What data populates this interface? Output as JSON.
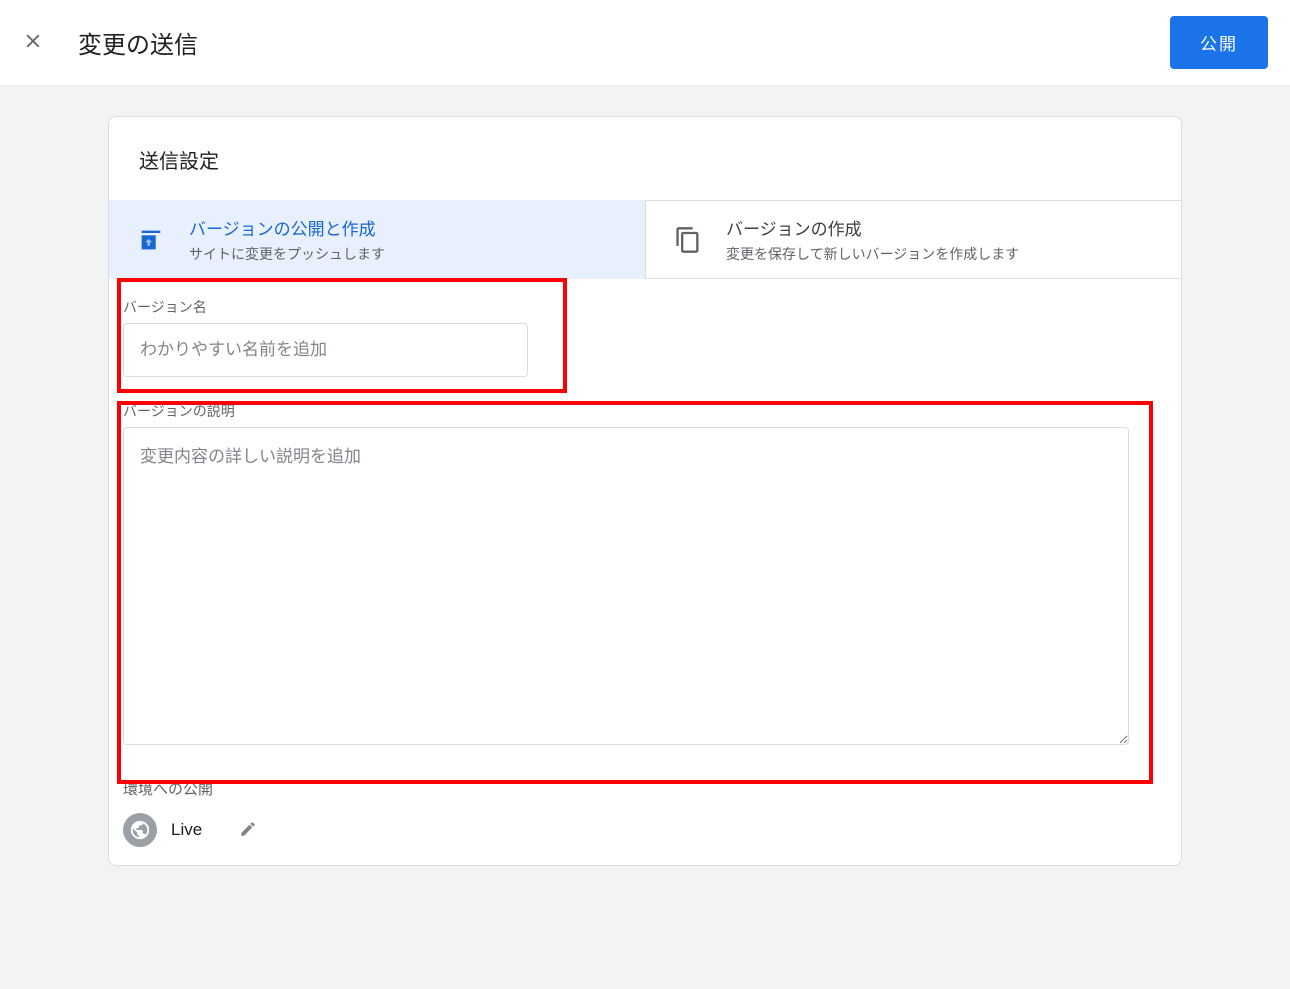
{
  "header": {
    "title": "変更の送信",
    "publish_label": "公開"
  },
  "card": {
    "settings_title": "送信設定",
    "tabs": [
      {
        "title": "バージョンの公開と作成",
        "desc": "サイトに変更をプッシュします"
      },
      {
        "title": "バージョンの作成",
        "desc": "変更を保存して新しいバージョンを作成します"
      }
    ],
    "version_name": {
      "label": "バージョン名",
      "placeholder": "わかりやすい名前を追加",
      "value": ""
    },
    "version_desc": {
      "label": "バージョンの説明",
      "placeholder": "変更内容の詳しい説明を追加",
      "value": ""
    },
    "env": {
      "label": "環境への公開",
      "name": "Live"
    }
  }
}
